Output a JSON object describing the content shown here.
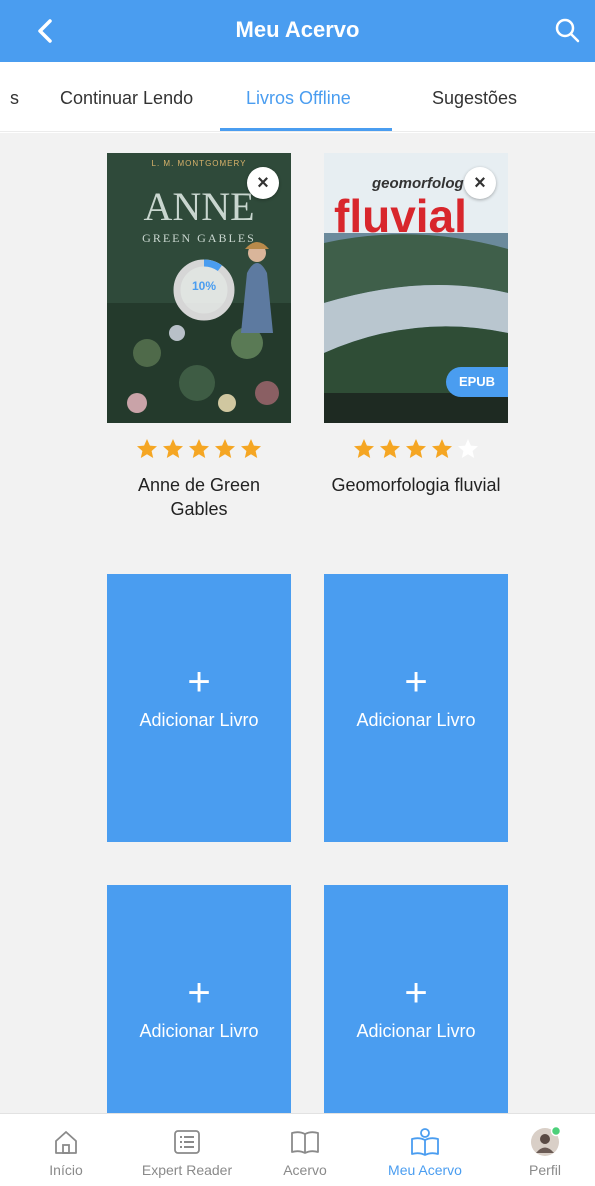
{
  "header": {
    "title": "Meu Acervo",
    "back_icon": "chevron-left-icon",
    "search_icon": "search-icon"
  },
  "tabs": [
    {
      "label": "s",
      "active": false
    },
    {
      "label": "Continuar Lendo",
      "active": false
    },
    {
      "label": "Livros Offline",
      "active": true
    },
    {
      "label": "Sugestões",
      "active": false
    }
  ],
  "books": [
    {
      "title": "Anne de Green Gables",
      "cover_title_top": "ANNE",
      "cover_title_bottom": "GREEN GABLES",
      "cover_author": "L. M. MONTGOMERY",
      "progress": "10%",
      "rating": 5
    },
    {
      "title": "Geomorfologia fluvial",
      "cover_title_top": "geomorfolog",
      "cover_title_bottom": "fluvial",
      "format_badge": "EPUB",
      "rating": 4
    }
  ],
  "add_cards": [
    {
      "plus": "+",
      "label": "Adicionar Livro"
    },
    {
      "plus": "+",
      "label": "Adicionar Livro"
    },
    {
      "plus": "+",
      "label": "Adicionar Livro"
    },
    {
      "plus": "+",
      "label": "Adicionar Livro"
    }
  ],
  "bottom_nav": [
    {
      "label": "Início",
      "icon": "home-icon",
      "active": false
    },
    {
      "label": "Expert Reader",
      "icon": "list-icon",
      "active": false
    },
    {
      "label": "Acervo",
      "icon": "open-book-icon",
      "active": false
    },
    {
      "label": "Meu Acervo",
      "icon": "reader-icon",
      "active": true
    },
    {
      "label": "Perfil",
      "icon": "avatar-icon",
      "active": false
    }
  ],
  "colors": {
    "accent": "#4a9df0",
    "star": "#f5a623",
    "content_bg": "#f2f2f2"
  }
}
